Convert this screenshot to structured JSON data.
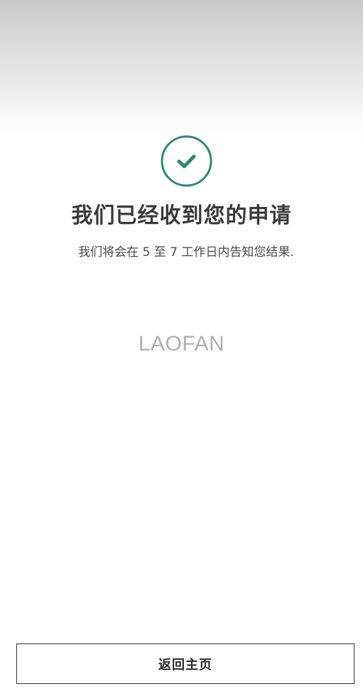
{
  "confirmation": {
    "icon": "check-circle-icon",
    "accent_color": "#2e8b73",
    "title": "我们已经收到您的申请",
    "message": "我们将会在 5 至 7 工作日内告知您结果."
  },
  "watermark": {
    "text": "LAOFAN"
  },
  "footer": {
    "home_button_label": "返回主页"
  }
}
